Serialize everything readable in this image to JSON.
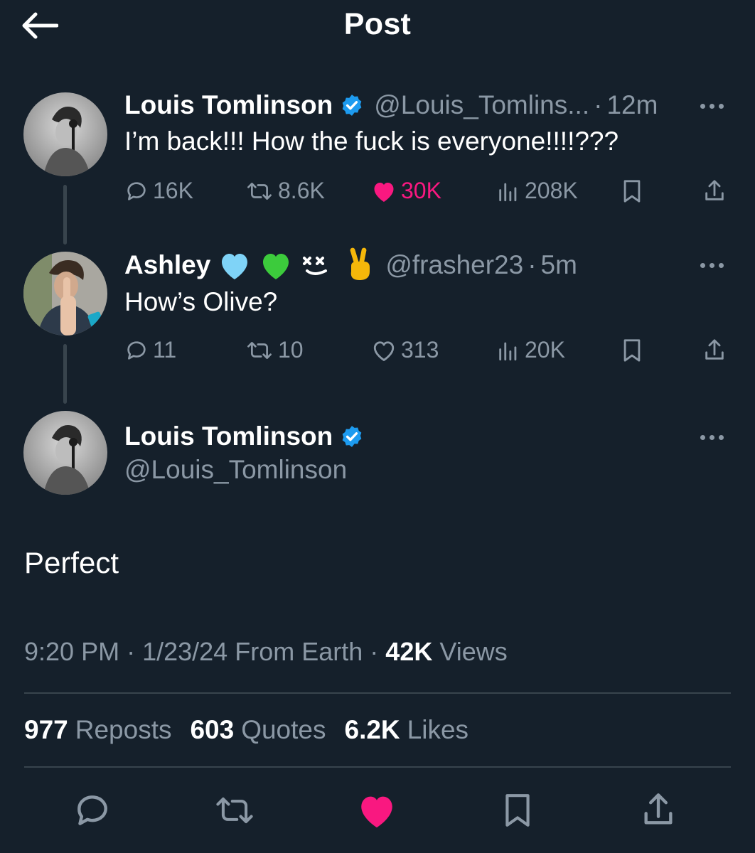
{
  "header": {
    "title": "Post"
  },
  "thread": [
    {
      "author_name": "Louis Tomlinson",
      "handle": "@Louis_Tomlins...",
      "time": "12m",
      "text": "I’m back!!! How the fuck is everyone!!!!???",
      "replies": "16K",
      "reposts": "8.6K",
      "likes": "30K",
      "views": "208K",
      "liked": true
    },
    {
      "author_name": "Ashley",
      "handle": "@frasher23",
      "time": "5m",
      "text": "How’s Olive?",
      "replies": "11",
      "reposts": "10",
      "likes": "313",
      "views": "20K",
      "liked": false,
      "name_emojis": [
        "light-blue-heart",
        "green-heart",
        "dizzy-face-emoji",
        "victory-hand"
      ]
    }
  ],
  "main_post": {
    "author_name": "Louis Tomlinson",
    "handle": "@Louis_Tomlinson",
    "text": "Perfect",
    "time": "9:20 PM",
    "date": "1/23/24",
    "source": "From Earth",
    "views_count": "42K",
    "views_label": "Views",
    "reposts_count": "977",
    "reposts_label": "Reposts",
    "quotes_count": "603",
    "quotes_label": "Quotes",
    "likes_count": "6.2K",
    "likes_label": "Likes"
  },
  "colors": {
    "background": "#15202b",
    "secondary_text": "#8b98a5",
    "like_pink": "#f91880",
    "verified_blue": "#1d9bf0",
    "divider": "#38444d"
  }
}
